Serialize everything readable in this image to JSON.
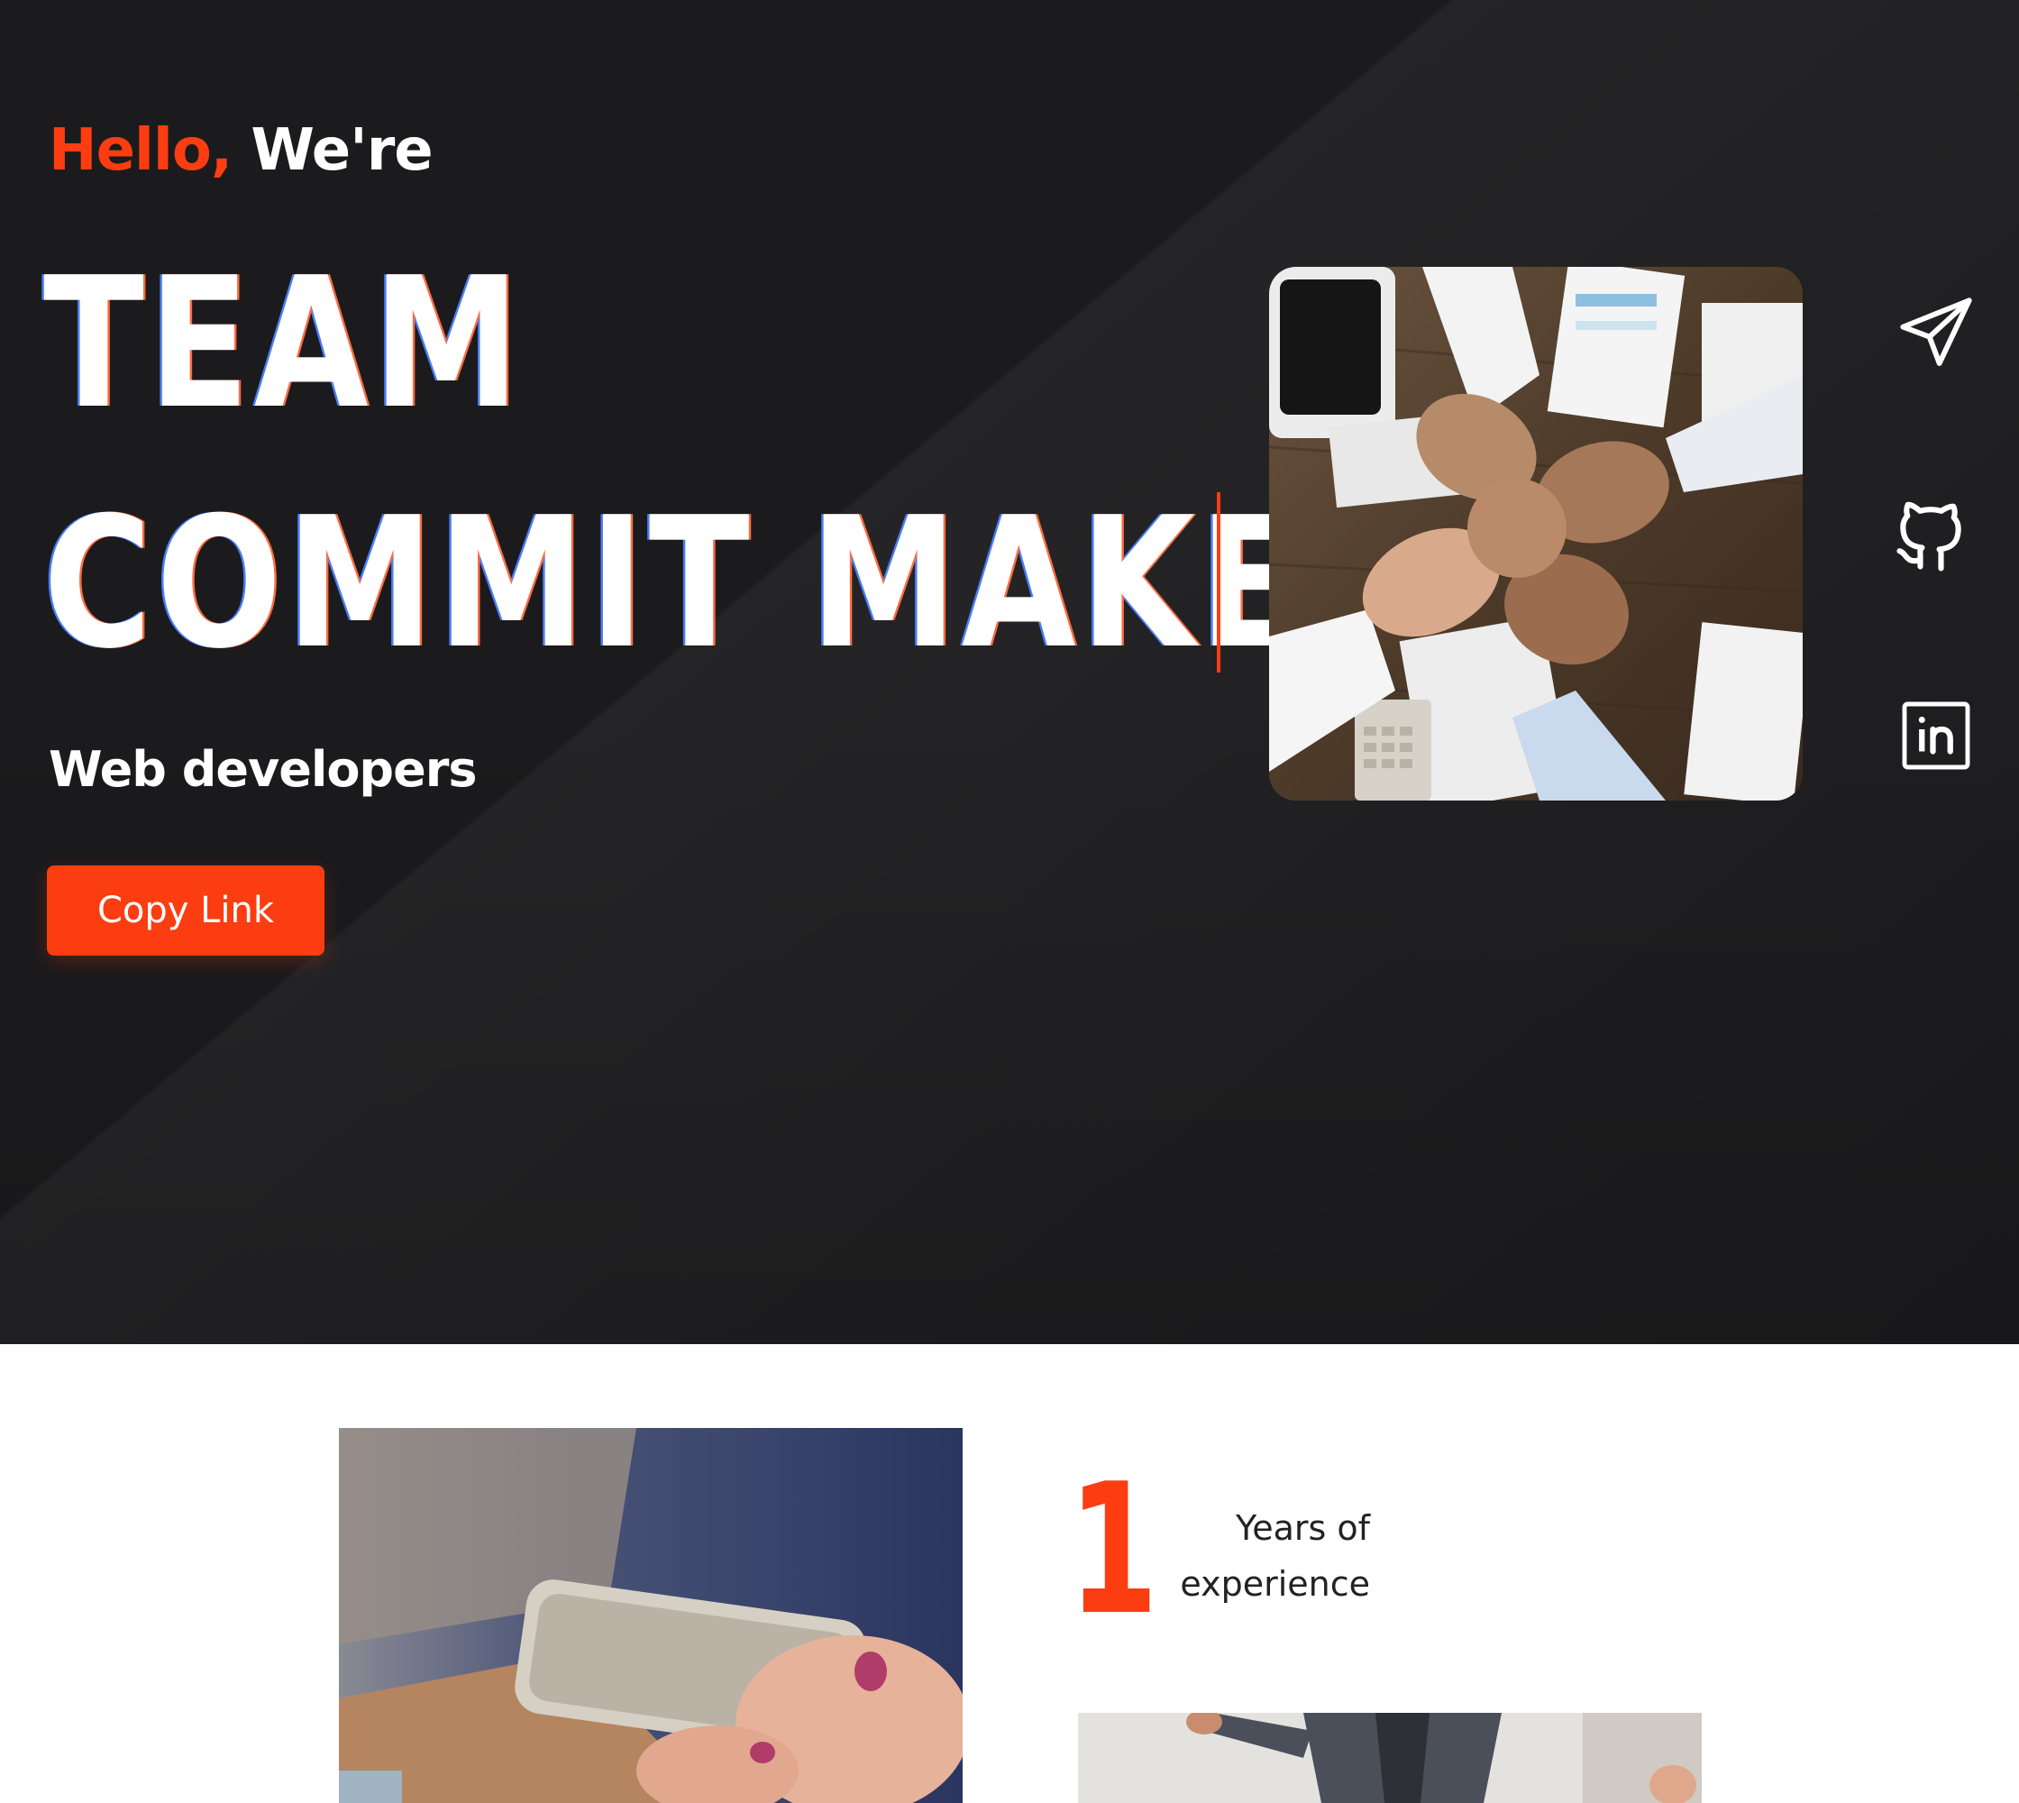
{
  "hero": {
    "greeting_hello": "Hello,",
    "greeting_were": "We're",
    "title_line1": "TEAM",
    "title_line2": "COMMIT MAKERS",
    "subtitle": "Web developers",
    "copy_button_label": "Copy Link",
    "image_alt": "Team hands in a fist bump over a desk"
  },
  "social": [
    {
      "name": "telegram",
      "icon": "paper-plane-icon"
    },
    {
      "name": "github",
      "icon": "github-icon"
    },
    {
      "name": "linkedin",
      "icon": "linkedin-icon"
    }
  ],
  "stats": {
    "years_value": "1",
    "years_label_line1": "Years of",
    "years_label_line2": "experience"
  },
  "colors": {
    "accent": "#fc3d12",
    "hero_background": "#1b1b1d",
    "text_light": "#ffffff"
  }
}
